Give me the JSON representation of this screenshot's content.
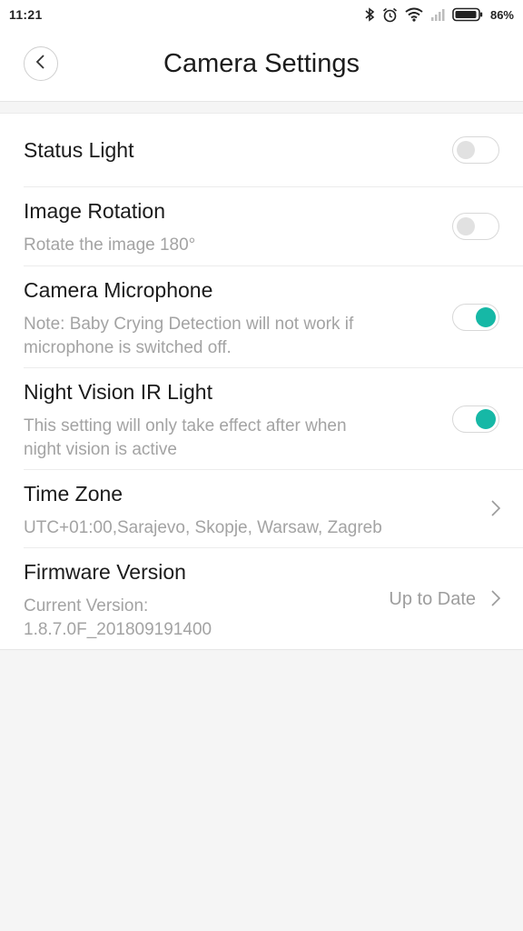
{
  "status_bar": {
    "time": "11:21",
    "battery_percent": "86%",
    "icons": [
      "bluetooth-icon",
      "alarm-icon",
      "wifi-icon",
      "signal-icon",
      "battery-icon"
    ]
  },
  "header": {
    "title": "Camera Settings",
    "back_icon": "chevron-left-icon"
  },
  "settings": {
    "status_light": {
      "title": "Status Light",
      "enabled": false
    },
    "image_rotation": {
      "title": "Image Rotation",
      "subtitle": "Rotate the image 180°",
      "enabled": false
    },
    "camera_microphone": {
      "title": "Camera Microphone",
      "subtitle": "Note: Baby Crying Detection will not work if microphone is switched off.",
      "enabled": true
    },
    "night_vision": {
      "title": "Night Vision IR Light",
      "subtitle": "This setting will only take effect after when night vision is active",
      "enabled": true
    },
    "time_zone": {
      "title": "Time Zone",
      "subtitle": "UTC+01:00,Sarajevo, Skopje, Warsaw, Zagreb"
    },
    "firmware": {
      "title": "Firmware Version",
      "subtitle_line1": "Current Version:",
      "subtitle_line2": "1.8.7.0F_201809191400",
      "status": "Up to Date"
    }
  },
  "colors": {
    "accent": "#16b8a6",
    "background": "#f5f5f5",
    "secondary_text": "#a3a3a3"
  }
}
